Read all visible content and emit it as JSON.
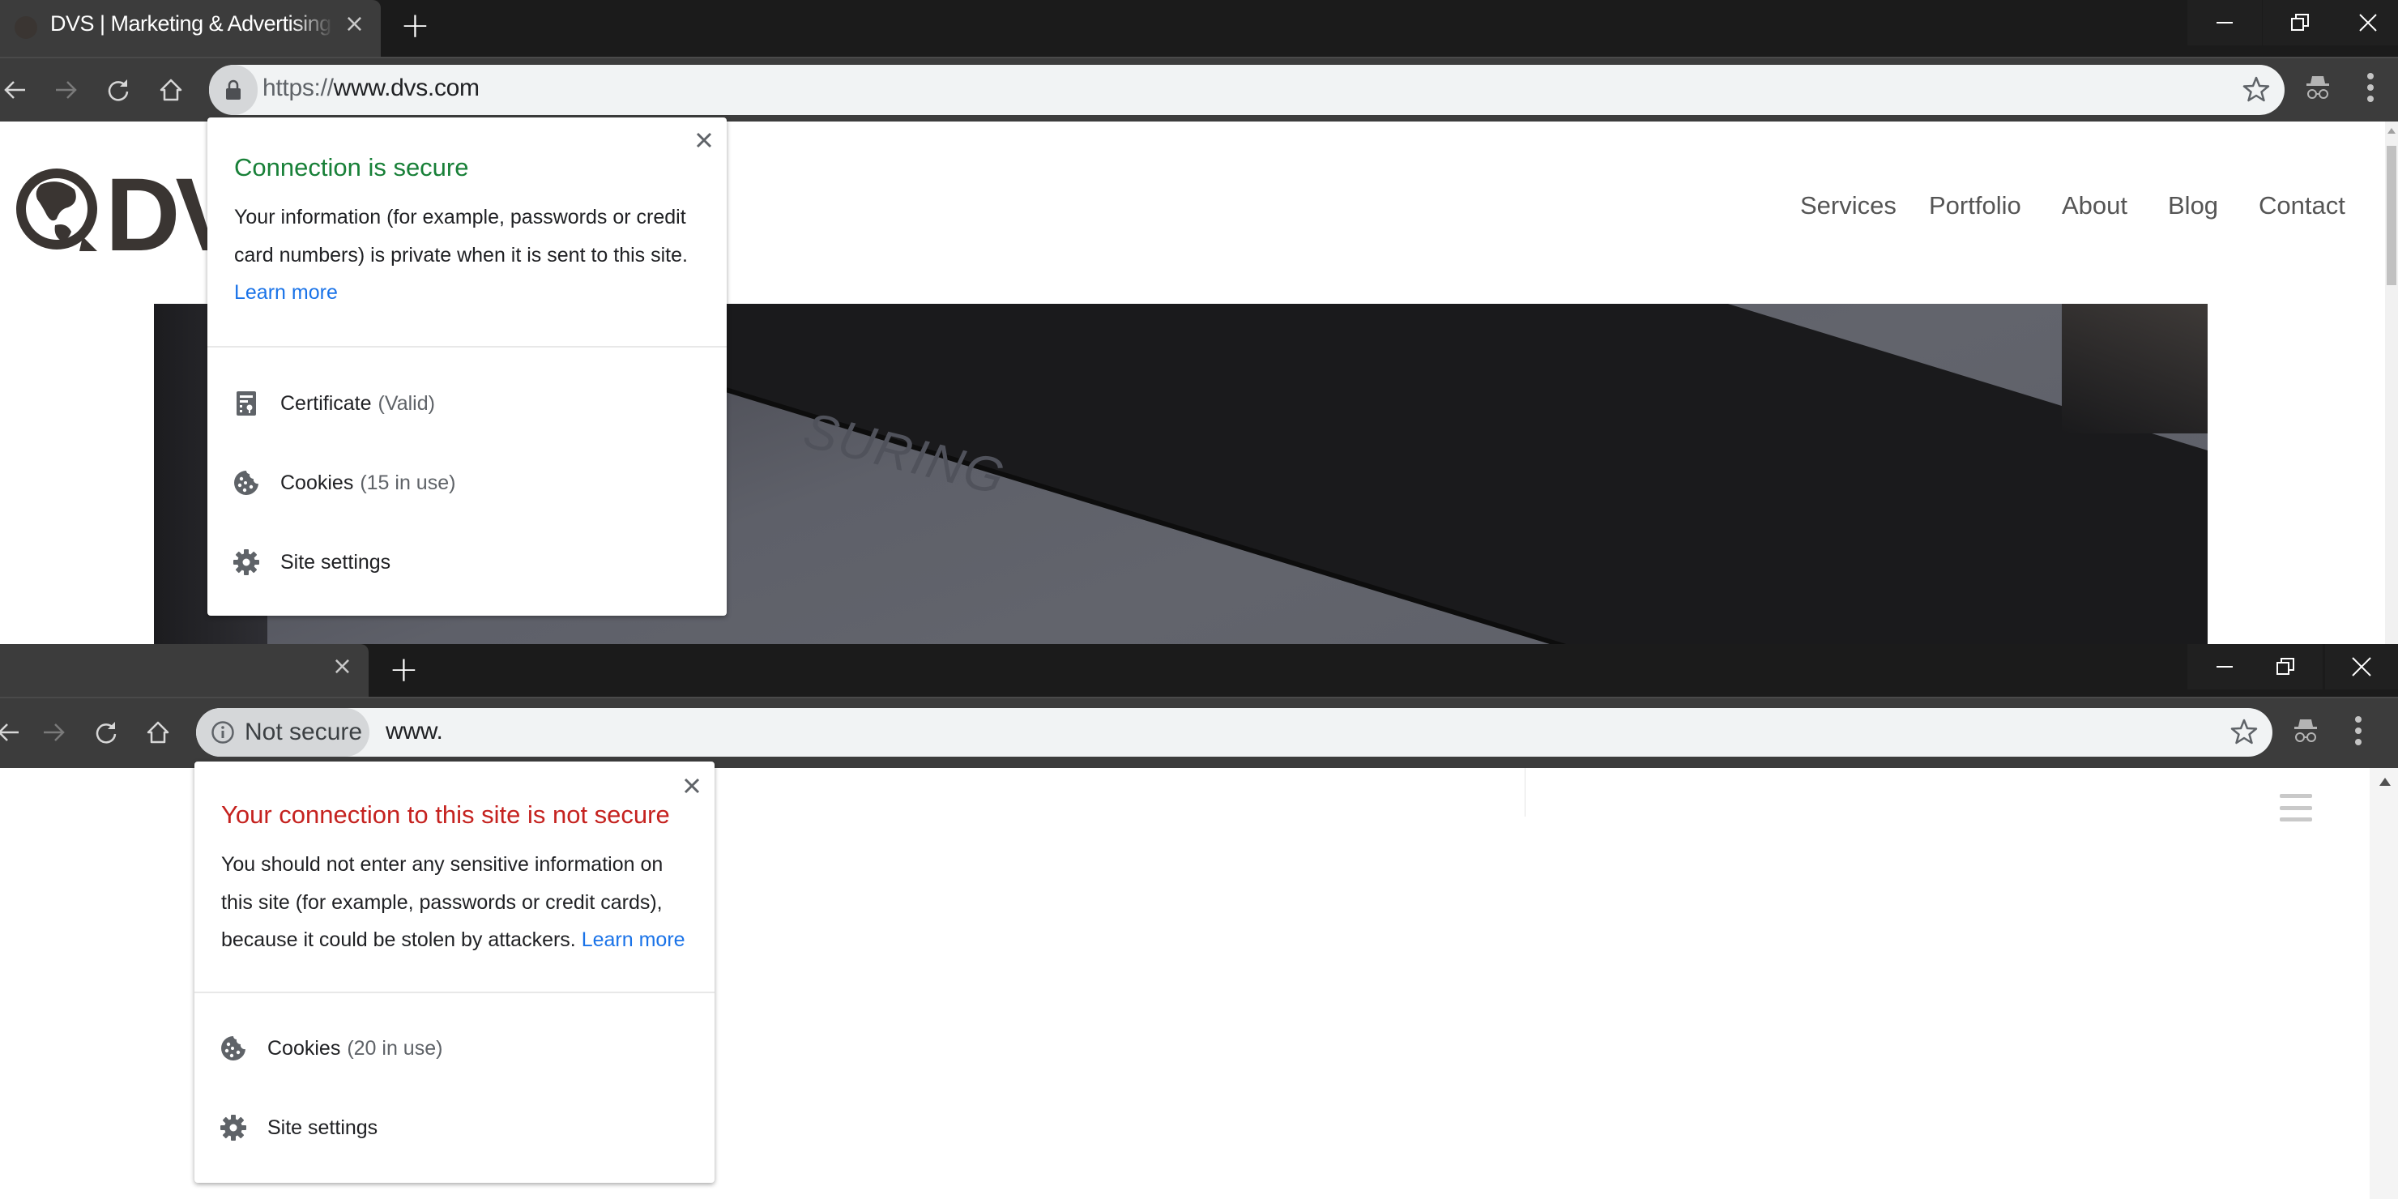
{
  "windows": [
    {
      "tab": {
        "title": "DVS | Marketing & Advertising Agency",
        "close": "×"
      },
      "new_tab": "+",
      "omnibox": {
        "scheme": "https://",
        "host": "www.dvs.com",
        "security_state": "secure",
        "security_icon": "lock-icon"
      },
      "toolbar_icons": [
        "back-arrow-icon",
        "forward-arrow-icon",
        "reload-icon",
        "home-icon",
        "star-icon",
        "incognito-icon",
        "kebab-menu-icon"
      ],
      "site": {
        "logo_text": "DVS",
        "logo_icon": "globe-icon",
        "nav": [
          "Services",
          "Portfolio",
          "About",
          "Blog",
          "Contact"
        ],
        "hero_text": "SURING"
      },
      "popup": {
        "title": "Connection is secure",
        "body": "Your information (for example, passwords or credit card numbers) is private when it is sent to this site.",
        "learn_more": "Learn more",
        "close": "close-icon",
        "rows": [
          {
            "icon": "certificate-icon",
            "label": "Certificate",
            "detail": "(Valid)"
          },
          {
            "icon": "cookie-icon",
            "label": "Cookies",
            "detail": "(15 in use)"
          },
          {
            "icon": "gear-icon",
            "label": "Site settings",
            "detail": ""
          }
        ]
      }
    },
    {
      "tab": {
        "title": "",
        "close": "×"
      },
      "new_tab": "+",
      "omnibox": {
        "security_label": "Not secure",
        "security_state": "not-secure",
        "security_icon": "info-icon",
        "url": "www."
      },
      "toolbar_icons": [
        "back-arrow-icon",
        "forward-arrow-icon",
        "reload-icon",
        "home-icon",
        "star-icon",
        "incognito-icon",
        "kebab-menu-icon"
      ],
      "site": {
        "menu_icon": "hamburger-icon"
      },
      "popup": {
        "title": "Your connection to this site is not secure",
        "body": "You should not enter any sensitive information on this site (for example, passwords or credit cards), because it could be stolen by attackers.",
        "learn_more": "Learn more",
        "close": "close-icon",
        "rows": [
          {
            "icon": "cookie-icon",
            "label": "Cookies",
            "detail": "(20 in use)"
          },
          {
            "icon": "gear-icon",
            "label": "Site settings",
            "detail": ""
          }
        ]
      }
    }
  ],
  "colors": {
    "secure_title": "#188038",
    "insecure_title": "#c5221f",
    "link": "#1a73e8",
    "chrome_dark": "#3c3c3c",
    "titlebar": "#1b1b1b"
  }
}
